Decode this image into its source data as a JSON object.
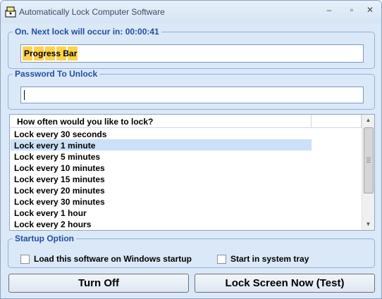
{
  "window": {
    "title": "Automatically Lock Computer Software",
    "controls": {
      "minimize": "–",
      "maximize": "▫",
      "close": "✕"
    }
  },
  "status_group": {
    "legend": "On. Next lock will occur in: 00:00:41",
    "progress": {
      "label": "Progress Bar",
      "filled_chunks": 5
    },
    "accent_color": "#ffd24a"
  },
  "password_group": {
    "legend": "Password To Unlock",
    "value": ""
  },
  "interval_list": {
    "header": "How often would you like to lock?",
    "items": [
      "Lock every 30 seconds",
      "Lock every 1 minute",
      "Lock every 5 minutes",
      "Lock every 10 minutes",
      "Lock every 15 minutes",
      "Lock every 20 minutes",
      "Lock every 30 minutes",
      "Lock every 1 hour",
      "Lock every 2 hours"
    ],
    "selected_index": 1
  },
  "startup_group": {
    "legend": "Startup Option",
    "load_on_startup": {
      "label": "Load this software on Windows startup",
      "checked": false
    },
    "system_tray": {
      "label": "Start in system tray",
      "checked": false
    }
  },
  "buttons": {
    "turn_off": "Turn Off",
    "lock_now": "Lock Screen Now (Test)"
  }
}
